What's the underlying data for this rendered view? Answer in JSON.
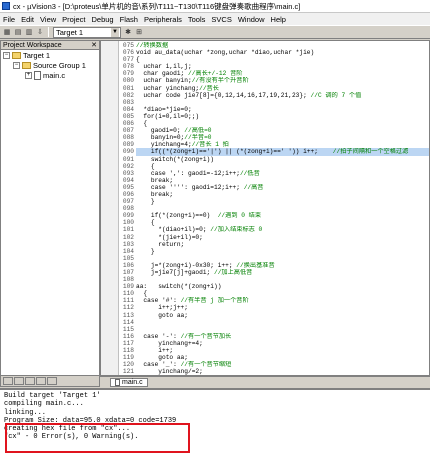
{
  "window": {
    "title": "cx - µVision3 - [D:\\proteus\\单片机的音\\系列\\T111~T130\\T116键盘弹奏歌曲程序\\main.c]"
  },
  "menu": [
    "File",
    "Edit",
    "View",
    "Project",
    "Debug",
    "Flash",
    "Peripherals",
    "Tools",
    "SVCS",
    "Window",
    "Help"
  ],
  "toolbar": {
    "target": "Target 1"
  },
  "workspace": {
    "title": "Project Workspace",
    "tree": [
      {
        "label": "Target 1"
      },
      {
        "label": "Source Group 1"
      },
      {
        "label": "main.c"
      }
    ]
  },
  "editor": {
    "tab": "main.c",
    "lines": [
      {
        "n": "075",
        "t": "//转换数据",
        "c": "cmt"
      },
      {
        "n": "076",
        "t": "void au_data(uchar *zong,uchar *diao,uchar *jie)"
      },
      {
        "n": "077",
        "t": "{"
      },
      {
        "n": "078",
        "t": "  uchar i,il,j;"
      },
      {
        "n": "079",
        "t": "  char gaodi; //高长+/-12 音阶"
      },
      {
        "n": "080",
        "t": "  uchar banyin;//有没有半个升音阶"
      },
      {
        "n": "081",
        "t": "  uchar yinchang;//音长"
      },
      {
        "n": "082",
        "t": "  uchar code jie7[8]={0,12,14,16,17,19,21,23}; //C 调的 7 个值"
      },
      {
        "n": "083",
        "t": ""
      },
      {
        "n": "084",
        "t": "  *diao=*jie=0;"
      },
      {
        "n": "085",
        "t": "  for(i=0,il=0;;)"
      },
      {
        "n": "086",
        "t": "  {"
      },
      {
        "n": "087",
        "t": "    gaodi=0; //高低=0"
      },
      {
        "n": "088",
        "t": "    banyin=0;//半音=0"
      },
      {
        "n": "089",
        "t": "    yinchang=4;//音长 1 拍"
      },
      {
        "n": "090",
        "t": "    if((*(zong+i)=='|') || (*(zong+i)==' ')) i++;    //拍子间隔和一个空格过滤"
      },
      {
        "n": "091",
        "t": "    switch(*(zong+i))"
      },
      {
        "n": "092",
        "t": "    {"
      },
      {
        "n": "093",
        "t": "    case ',': gaodi=-12;i++;//低音"
      },
      {
        "n": "094",
        "t": "    break;"
      },
      {
        "n": "095",
        "t": "    case '''': gaodi=12;i++; //高音"
      },
      {
        "n": "096",
        "t": "    break;"
      },
      {
        "n": "097",
        "t": "    }"
      },
      {
        "n": "098",
        "t": ""
      },
      {
        "n": "099",
        "t": "    if(*(zong+i)==0)  //遇到 0 结束"
      },
      {
        "n": "100",
        "t": "    {"
      },
      {
        "n": "101",
        "t": "      *(diao+il)=0; //加入结束标志 0"
      },
      {
        "n": "102",
        "t": "      *(jie+il)=0;"
      },
      {
        "n": "103",
        "t": "      return;"
      },
      {
        "n": "104",
        "t": "    }"
      },
      {
        "n": "105",
        "t": ""
      },
      {
        "n": "106",
        "t": "    j=*(zong+i)-0x30; i++; //换出基准音"
      },
      {
        "n": "107",
        "t": "    j=jie7[j]+gaodi; //加上高低音"
      },
      {
        "n": "108",
        "t": ""
      },
      {
        "n": "109",
        "t": "aa:   switch(*(zong+i))"
      },
      {
        "n": "110",
        "t": "  {"
      },
      {
        "n": "111",
        "t": "  case '#': //有半音 j 加一个音阶"
      },
      {
        "n": "112",
        "t": "      i++;j++;"
      },
      {
        "n": "113",
        "t": "      goto aa;"
      },
      {
        "n": "114",
        "t": ""
      },
      {
        "n": "115",
        "t": ""
      },
      {
        "n": "116",
        "t": "  case '-': //有一个音节加长"
      },
      {
        "n": "117",
        "t": "      yinchang+=4;"
      },
      {
        "n": "118",
        "t": "      i++;"
      },
      {
        "n": "119",
        "t": "      goto aa;"
      },
      {
        "n": "120",
        "t": "  case '_': //有一个音节缩短"
      },
      {
        "n": "121",
        "t": "      yinchang/=2;"
      },
      {
        "n": "122",
        "t": "      i++;"
      }
    ]
  },
  "output": {
    "lines": [
      "Build target 'Target 1'",
      "compiling main.c...",
      "linking...",
      "Program Size: data=95.0 xdata=0 code=1739",
      "creating hex file from \"cx\"...",
      "\"cx\" - 0 Error(s), 0 Warning(s)."
    ]
  }
}
